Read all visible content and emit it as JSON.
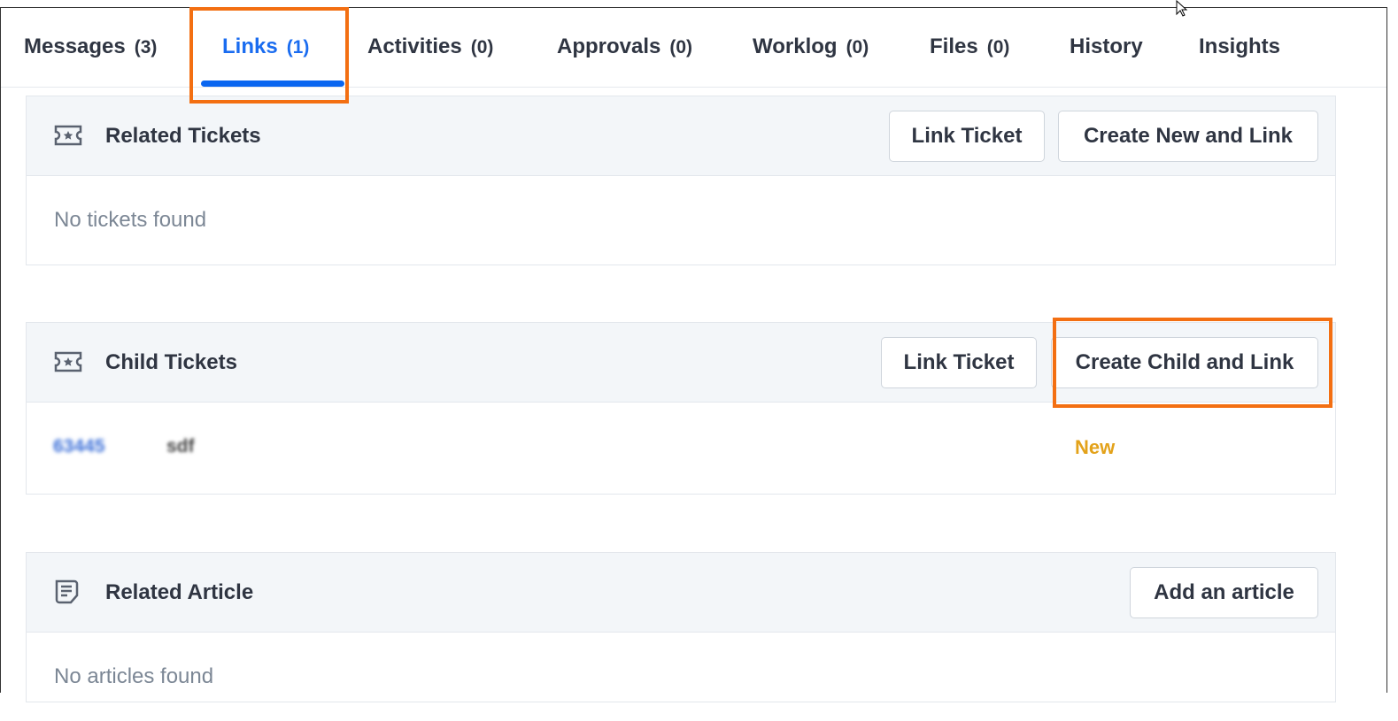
{
  "tabs": [
    {
      "label": "Messages",
      "count": "(3)"
    },
    {
      "label": "Links",
      "count": "(1)"
    },
    {
      "label": "Activities",
      "count": "(0)"
    },
    {
      "label": "Approvals",
      "count": "(0)"
    },
    {
      "label": "Worklog",
      "count": "(0)"
    },
    {
      "label": "Files",
      "count": "(0)"
    },
    {
      "label": "History"
    },
    {
      "label": "Insights"
    }
  ],
  "related_tickets": {
    "title": "Related Tickets",
    "link_button": "Link Ticket",
    "create_button": "Create New and Link",
    "empty": "No tickets found"
  },
  "child_tickets": {
    "title": "Child Tickets",
    "link_button": "Link Ticket",
    "create_button": "Create Child and Link",
    "rows": [
      {
        "id": "63445",
        "subject": "sdf",
        "status": "New"
      }
    ]
  },
  "related_article": {
    "title": "Related Article",
    "add_button": "Add an article",
    "empty": "No articles found"
  },
  "colors": {
    "accent": "#0a66f0",
    "highlight": "#f36f12",
    "status_new": "#e3a21a"
  }
}
